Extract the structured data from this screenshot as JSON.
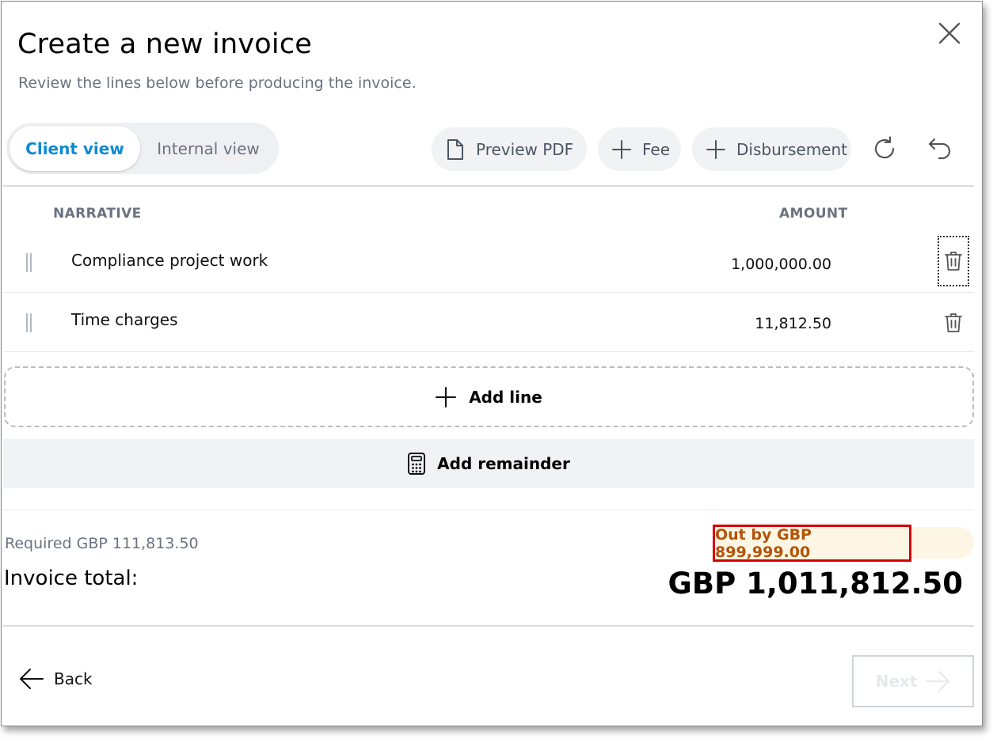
{
  "dialog": {
    "title": "Create a new invoice",
    "subtitle": "Review the lines below before producing the invoice."
  },
  "view_toggle": {
    "options": [
      "Client view",
      "Internal view"
    ],
    "selected": "Client view"
  },
  "toolbar": {
    "preview_pdf": "Preview PDF",
    "fee": "Fee",
    "disbursement": "Disbursement"
  },
  "table": {
    "columns": [
      "NARRATIVE",
      "AMOUNT"
    ],
    "rows": [
      {
        "narrative": "Compliance project work",
        "amount": "1,000,000.00"
      },
      {
        "narrative": "Time charges",
        "amount": "11,812.50"
      }
    ]
  },
  "actions": {
    "add_line": "Add line",
    "add_remainder": "Add remainder"
  },
  "summary": {
    "required": "Required GBP 111,813.50",
    "out_by": "Out by GBP 899,999.00",
    "total_label": "Invoice total:",
    "total_value": "GBP 1,011,812.50"
  },
  "footer": {
    "back": "Back",
    "next": "Next"
  },
  "colors": {
    "accent": "#0e8ad0",
    "warning_text": "#b3540a",
    "highlight_border": "#d70000"
  }
}
